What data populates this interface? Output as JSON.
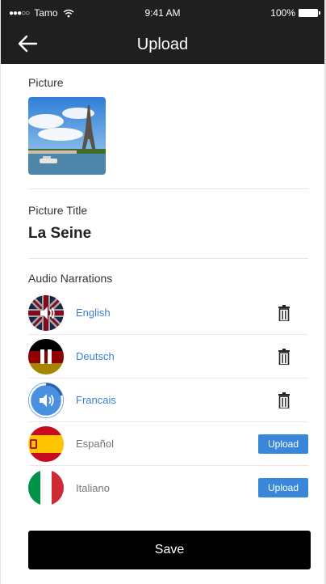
{
  "status": {
    "carrier": "Tamo",
    "time": "9:41 AM",
    "battery": "100%",
    "signal_dots": "●●●○○"
  },
  "header": {
    "title": "Upload"
  },
  "picture": {
    "label": "Picture"
  },
  "picture_title": {
    "label": "Picture Title",
    "value": "La Seine"
  },
  "audio": {
    "label": "Audio Narrations",
    "items": [
      {
        "language": "English",
        "state": "recorded",
        "control": "speaker-icon"
      },
      {
        "language": "Deutsch",
        "state": "playing",
        "control": "pause-icon"
      },
      {
        "language": "Francais",
        "state": "recorded",
        "control": "speaker-icon",
        "progress": 0.2
      },
      {
        "language": "Español",
        "state": "missing",
        "action": "Upload"
      },
      {
        "language": "Italiano",
        "state": "missing",
        "action": "Upload"
      }
    ]
  },
  "save_label": "Save",
  "colors": {
    "accent": "#3a86d9",
    "bar": "#1f1f1f",
    "save": "#000000"
  }
}
